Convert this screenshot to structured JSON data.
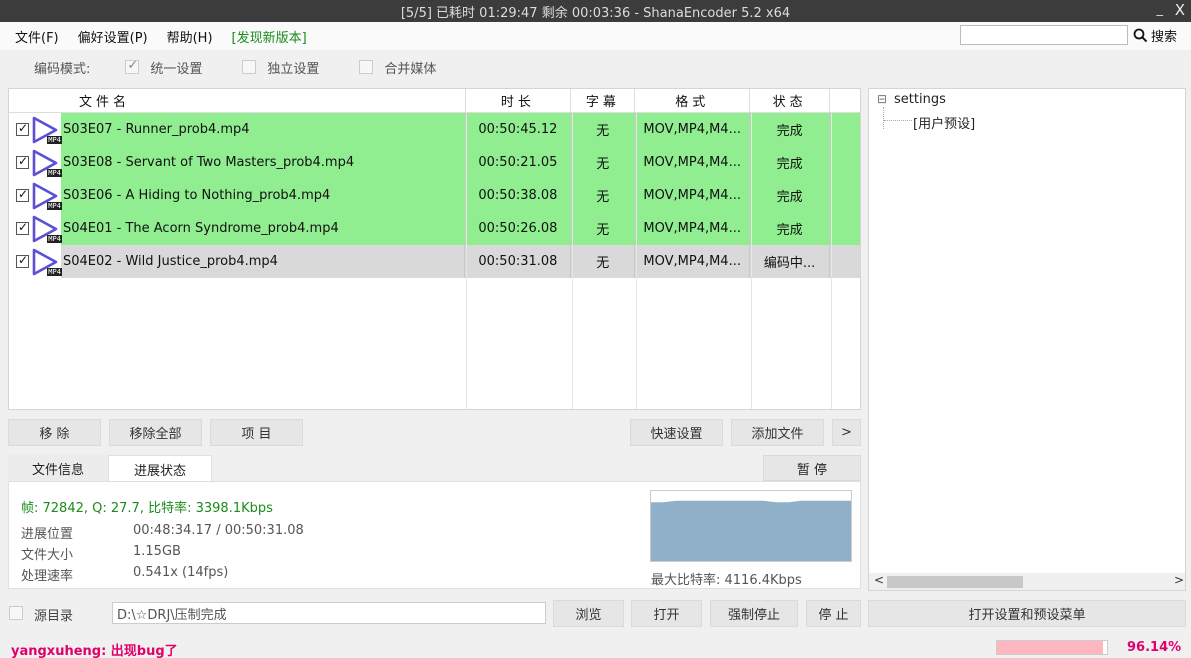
{
  "window": {
    "title": "[5/5] 已耗时 01:29:47  剩余 00:03:36 - ShanaEncoder 5.2 x64",
    "minimize_glyph": "_",
    "close_glyph": "X"
  },
  "menu": {
    "file": "文件(F)",
    "prefs": "偏好设置(P)",
    "help": "帮助(H)",
    "new_version": "[发现新版本]"
  },
  "search": {
    "value": "",
    "button_label": "搜索",
    "icon": "search-icon"
  },
  "mode": {
    "label": "编码模式:",
    "options": [
      {
        "label": "统一设置",
        "checked": true
      },
      {
        "label": "独立设置",
        "checked": false
      },
      {
        "label": "合并媒体",
        "checked": false
      }
    ]
  },
  "table": {
    "headers": [
      "文件名",
      "时长",
      "字幕",
      "格式",
      "状态"
    ],
    "rows": [
      {
        "checked": true,
        "name": "S03E07 - Runner_prob4.mp4",
        "duration": "00:50:45.12",
        "subtitle": "无",
        "format": "MOV,MP4,M4...",
        "status": "完成",
        "state": "done"
      },
      {
        "checked": true,
        "name": "S03E08 - Servant of Two Masters_prob4.mp4",
        "duration": "00:50:21.05",
        "subtitle": "无",
        "format": "MOV,MP4,M4...",
        "status": "完成",
        "state": "done"
      },
      {
        "checked": true,
        "name": "S03E06 - A Hiding to Nothing_prob4.mp4",
        "duration": "00:50:38.08",
        "subtitle": "无",
        "format": "MOV,MP4,M4...",
        "status": "完成",
        "state": "done"
      },
      {
        "checked": true,
        "name": "S04E01 - The Acorn Syndrome_prob4.mp4",
        "duration": "00:50:26.08",
        "subtitle": "无",
        "format": "MOV,MP4,M4...",
        "status": "完成",
        "state": "done"
      },
      {
        "checked": true,
        "name": "S04E02 - Wild Justice_prob4.mp4",
        "duration": "00:50:31.08",
        "subtitle": "无",
        "format": "MOV,MP4,M4...",
        "status": "编码中...",
        "state": "active"
      }
    ],
    "file_icon_tag": "MP4"
  },
  "buttons": {
    "remove": "移 除",
    "remove_all": "移除全部",
    "item": "项 目",
    "quick_settings": "快速设置",
    "add_file": "添加文件",
    "more": ">",
    "pause": "暂 停",
    "browse": "浏览",
    "open": "打开",
    "force_stop": "强制停止",
    "stop": "停 止",
    "open_settings": "打开设置和预设菜单"
  },
  "tabs": {
    "file_info": "文件信息",
    "progress": "进展状态"
  },
  "progress_panel": {
    "summary": "帧: 72842, Q: 27.7, 比特率: 3398.1Kbps",
    "position_label": "进展位置",
    "position_value": "00:48:34.17 / 00:50:31.08",
    "size_label": "文件大小",
    "size_value": "1.15GB",
    "speed_label": "处理速率",
    "speed_value": "0.541x (14fps)",
    "max_bitrate": "最大比特率: 4116.4Kbps"
  },
  "chart_data": {
    "type": "area",
    "series": [
      {
        "values": [
          0.84,
          0.84,
          0.86,
          0.86,
          0.86,
          0.86,
          0.86,
          0.86,
          0.86,
          0.86,
          0.84,
          0.84,
          0.86,
          0.86,
          0.86,
          0.86,
          0.86
        ]
      }
    ],
    "fill_color": "#8fb0c8",
    "ylim": [
      0,
      1
    ]
  },
  "tree": {
    "root": "settings",
    "child": "[用户预设]",
    "expand_glyph": "⊟"
  },
  "scroll": {
    "left": "<",
    "right": ">"
  },
  "source": {
    "label": "源目录",
    "checked": false,
    "path": "D:\\☆DRJ\\压制完成"
  },
  "status": {
    "message": "yangxuheng: 出现bug了",
    "percent_text": "96.14%",
    "progress": 0.9614,
    "progress_color": "#ffb6c1",
    "accent": "#e0006a"
  }
}
